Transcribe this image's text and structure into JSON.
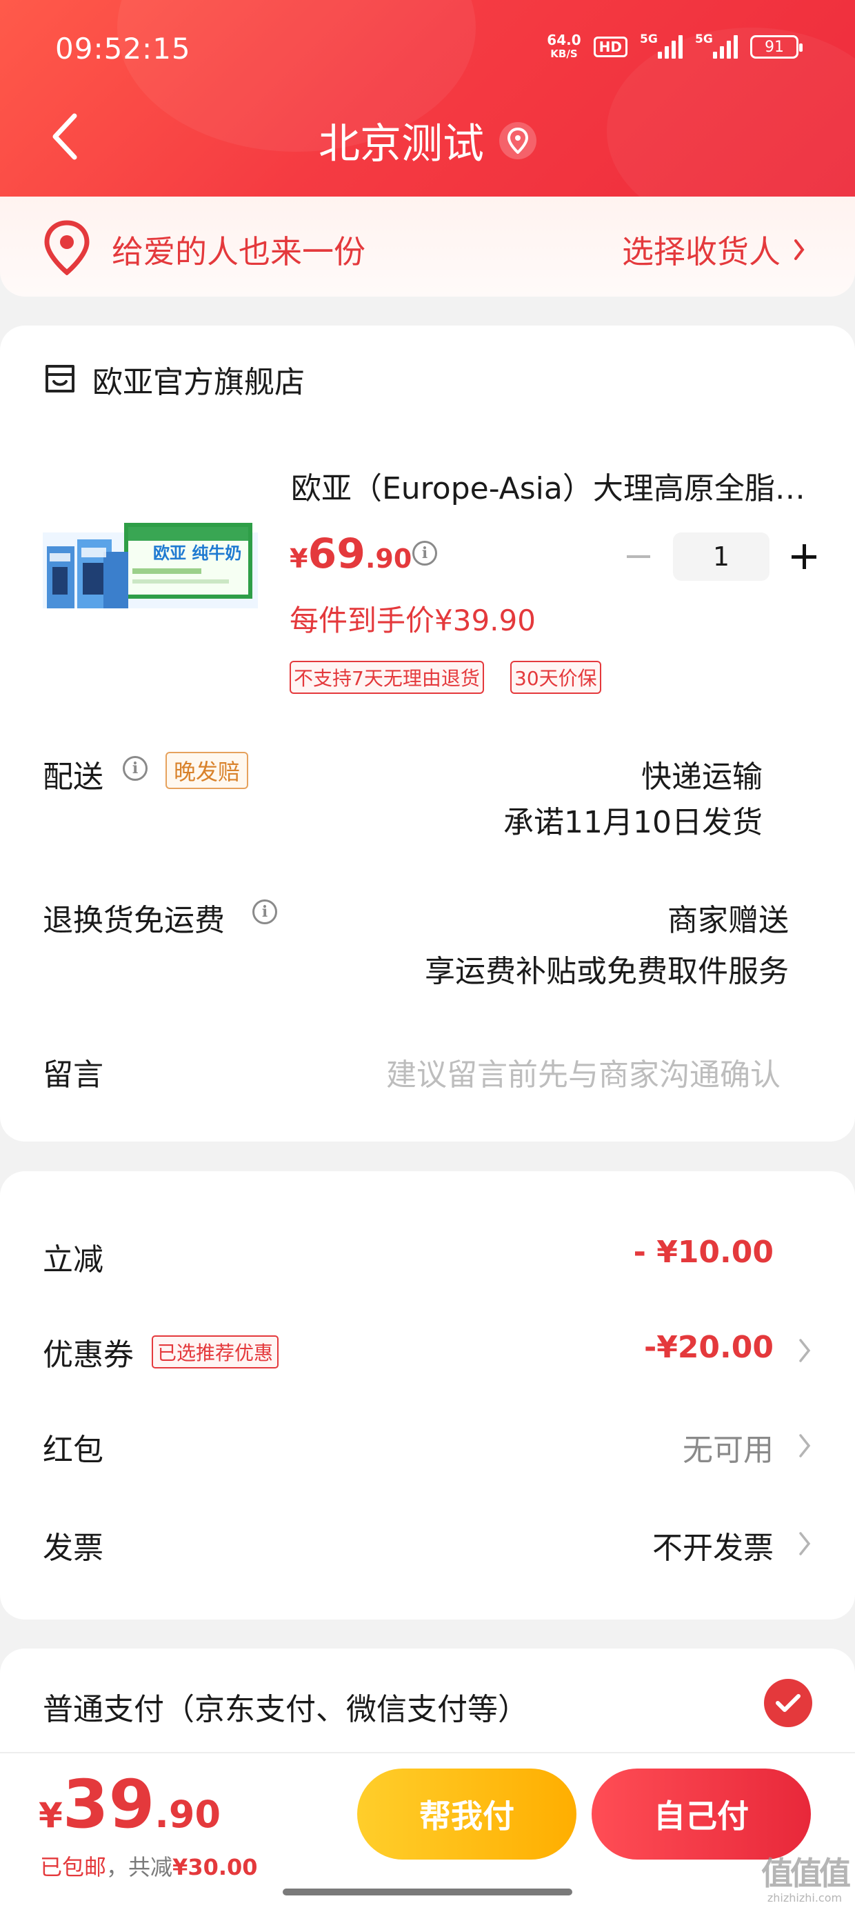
{
  "status_bar": {
    "time": "09:52:15",
    "net_speed_value": "64.0",
    "net_speed_unit": "KB/S",
    "hd_label": "HD",
    "sim1_label": "5G",
    "sim2_label": "5G",
    "battery": "91"
  },
  "header": {
    "title": "北京测试",
    "back_icon": "chevron-left-icon",
    "location_icon": "location-pin-icon"
  },
  "gift": {
    "text": "给爱的人也来一份",
    "action": "选择收货人"
  },
  "store": {
    "name": "欧亚官方旗舰店"
  },
  "product": {
    "name": "欧亚（Europe-Asia）大理高原全脂纯牛奶",
    "image_text": "欧亚 纯牛奶",
    "price_symbol": "¥",
    "price_int": "69",
    "price_dec": ".90",
    "unit_price": "每件到手价¥39.90",
    "tags": [
      "不支持7天无理由退货",
      "30天价保"
    ],
    "quantity": "1"
  },
  "delivery": {
    "label": "配送",
    "badge": "晚发赔",
    "method": "快递运输",
    "promise": "承诺11月10日发货"
  },
  "return_shipping": {
    "label": "退换货免运费",
    "value": "商家赠送",
    "desc": "享运费补贴或免费取件服务"
  },
  "note": {
    "label": "留言",
    "placeholder": "建议留言前先与商家沟通确认"
  },
  "discounts": {
    "instant_label": "立减",
    "instant_value": "- ¥10.00",
    "coupon_label": "优惠券",
    "coupon_tag": "已选推荐优惠",
    "coupon_value": "-¥20.00",
    "redpacket_label": "红包",
    "redpacket_value": "无可用",
    "invoice_label": "发票",
    "invoice_value": "不开发票"
  },
  "payment": {
    "label": "普通支付（京东支付、微信支付等）",
    "selected": true
  },
  "footer": {
    "total_symbol": "¥",
    "total_int": "39",
    "total_dec": ".90",
    "shipping_free": "已包邮",
    "sep": "，",
    "saved_prefix": "共减",
    "saved_amount": "¥30.00",
    "help_pay_label": "帮我付",
    "self_pay_label": "自己付"
  },
  "watermark": {
    "logo": "值值值",
    "url": "zhizhizhi.com"
  },
  "colors": {
    "brand_red": "#e4393c",
    "header_red": "#f53b42",
    "help_yellow": "#ffb800",
    "late_badge_orange": "#d9822b"
  }
}
